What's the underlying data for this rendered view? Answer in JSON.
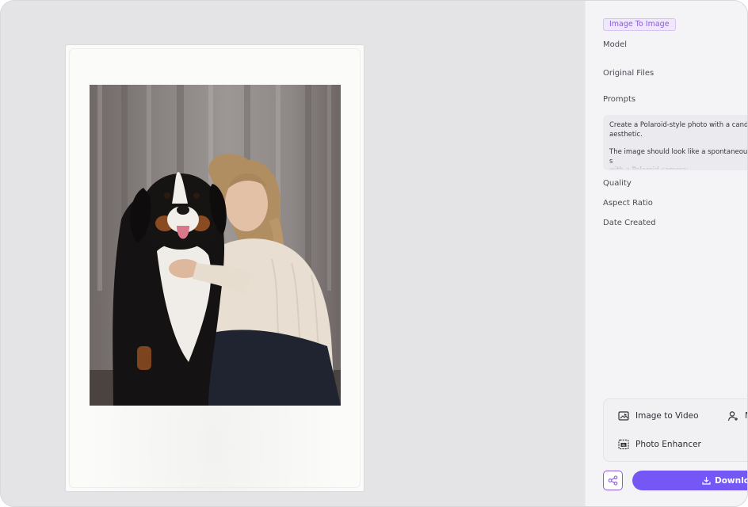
{
  "detail_panel": {
    "mode_tag": "Image To Image",
    "labels": {
      "model": "Model",
      "original_files": "Original Files",
      "prompts": "Prompts",
      "quality": "Quality",
      "aspect_ratio": "Aspect Ratio",
      "date_created": "Date Created"
    },
    "prompt_paragraph_1": "Create a Polaroid-style photo with a candi\naesthetic.",
    "prompt_paragraph_2": "The image should look like a spontaneous s\nwith a Polaroid camera:"
  },
  "tools": {
    "image_to_video": "Image to Video",
    "tool_2_truncated": "M",
    "photo_enhancer": "Photo Enhancer"
  },
  "actions": {
    "download_label": "Downloa"
  },
  "icons": {
    "image_to_video": "image-to-video-icon",
    "tool_2": "person-add-icon",
    "photo_enhancer": "photo-enhancer-icon",
    "share": "share-icon",
    "download": "download-icon"
  },
  "colors": {
    "accent": "#7457f5",
    "tag_text": "#8a5cd9",
    "tag_bg": "#efe7fb",
    "panel_bg": "#f4f4f7",
    "canvas_bg": "#e4e4e6"
  }
}
